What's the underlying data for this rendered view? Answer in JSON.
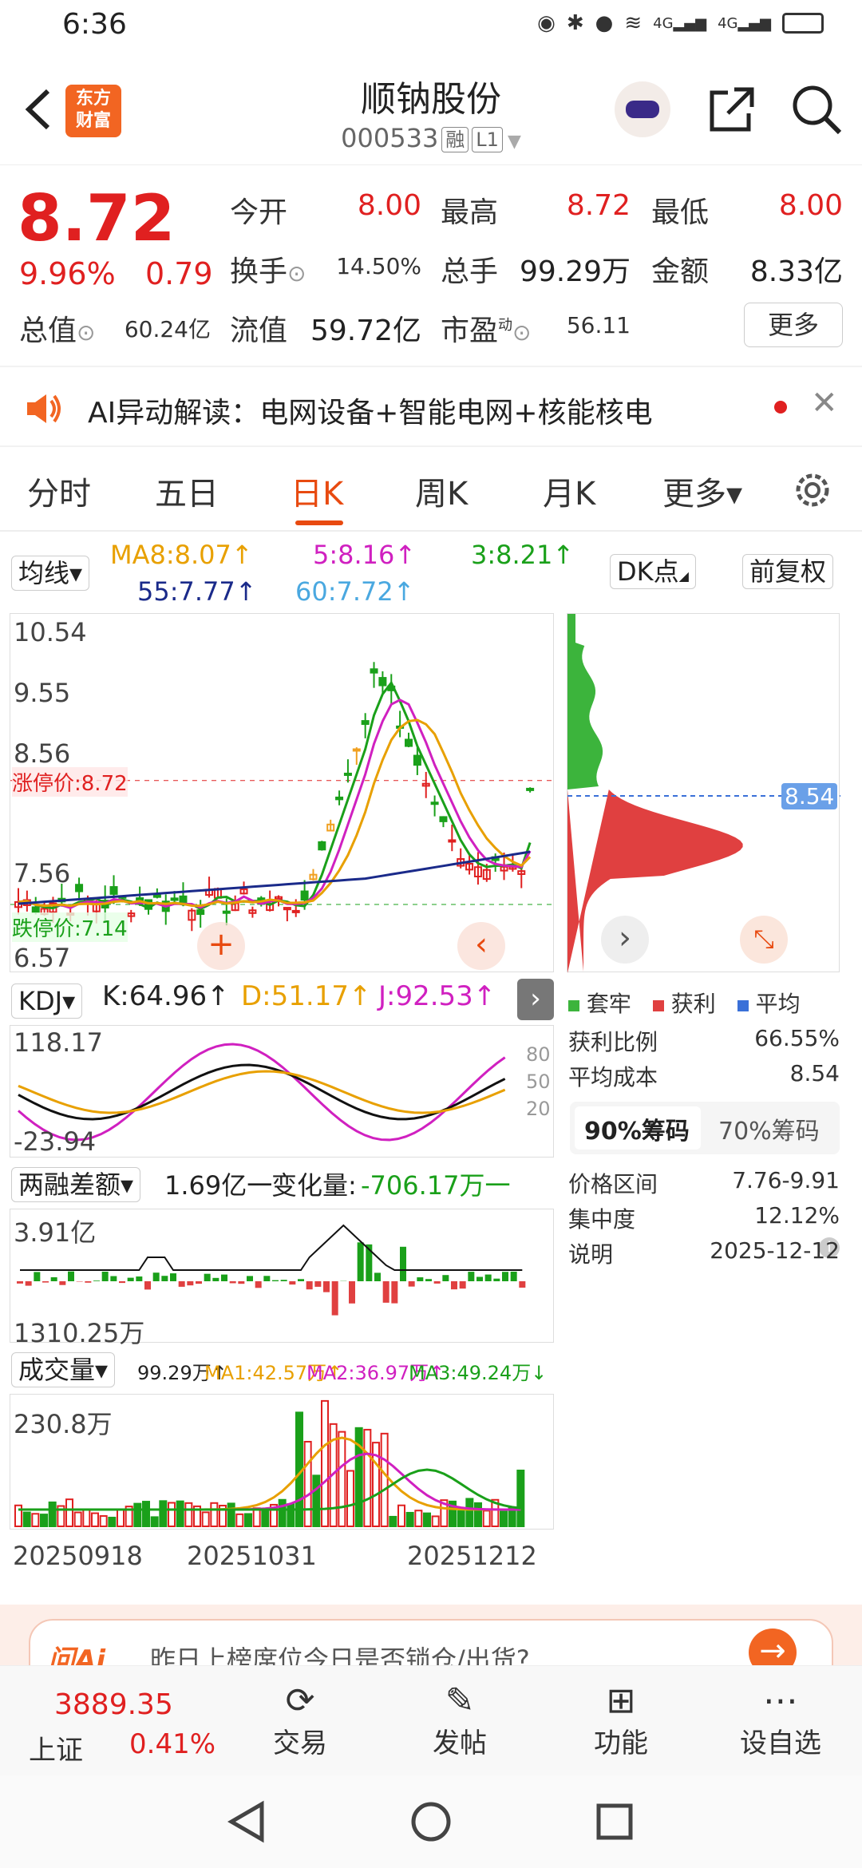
{
  "status": {
    "time": "6:36",
    "net1": "4G",
    "net2": "4G"
  },
  "header": {
    "logo_line1": "东方",
    "logo_line2": "财富",
    "title": "顺钠股份",
    "code": "000533",
    "tag1": "融",
    "tag2": "L1"
  },
  "quote": {
    "price": "8.72",
    "pct": "9.96%",
    "chg": "0.79",
    "open_lbl": "今开",
    "open": "8.00",
    "high_lbl": "最高",
    "high": "8.72",
    "low_lbl": "最低",
    "low": "8.00",
    "turn_lbl": "换手",
    "turn": "14.50%",
    "vol_lbl": "总手",
    "vol": "99.29万",
    "amt_lbl": "金额",
    "amt": "8.33亿",
    "mcap_lbl": "总值",
    "mcap": "60.24亿",
    "fcap_lbl": "流值",
    "fcap": "59.72亿",
    "pe_lbl": "市盈",
    "pe_sup": "动",
    "pe": "56.11",
    "more": "更多"
  },
  "ai": {
    "text": "AI异动解读：电网设备+智能电网+核能核电"
  },
  "tabs": [
    "分时",
    "五日",
    "日K",
    "周K",
    "月K",
    "更多▾"
  ],
  "kline": {
    "ma_select": "均线▾",
    "dk": "DK点",
    "fq": "前复权",
    "ma8": "MA8:8.07↑",
    "ma5": "5:8.16↑",
    "ma3": "3:8.21↑",
    "ma55": "55:7.77↑",
    "ma60": "60:7.72↑",
    "yticks": [
      "10.54",
      "9.55",
      "8.56",
      "7.56",
      "6.57"
    ],
    "limit_up": "涨停价:8.72",
    "limit_down": "跌停价:7.14",
    "cost_tag": "8.54"
  },
  "kdj": {
    "select": "KDJ▾",
    "k": "K:64.96↑",
    "d": "D:51.17↑",
    "j": "J:92.53↑",
    "ymax": "118.17",
    "ymin": "-23.94",
    "l80": "80",
    "l50": "50",
    "l20": "20"
  },
  "margin": {
    "select": "两融差额▾",
    "val": "1.69亿一",
    "chg_lbl": "变化量:",
    "chg": "-706.17万一",
    "ymax": "3.91亿",
    "ymin": "1310.25万"
  },
  "volume": {
    "select": "成交量▾",
    "v": "99.29万↑",
    "ma1": "MA1:42.57万↑",
    "ma2": "MA2:36.97万↑",
    "ma3": "MA3:49.24万↓",
    "ymax": "230.8万",
    "dates": [
      "20250918",
      "20251031",
      "20251212"
    ]
  },
  "chips": {
    "legend": [
      "套牢",
      "获利",
      "平均"
    ],
    "rows": [
      {
        "k": "获利比例",
        "v": "66.55%"
      },
      {
        "k": "平均成本",
        "v": "8.54"
      }
    ],
    "tab1": "90%筹码",
    "tab2": "70%筹码",
    "rows2": [
      {
        "k": "价格区间",
        "v": "7.76-9.91"
      },
      {
        "k": "集中度",
        "v": "12.12%"
      },
      {
        "k": "说明",
        "v": "2025-12-12"
      }
    ]
  },
  "banner": {
    "text": "昨日上榜席位今日是否锁仓/出货?"
  },
  "bottom": {
    "index_name": "上证",
    "index_val": "3889.35",
    "index_pct": "0.41%",
    "trade": "交易",
    "post": "发帖",
    "func": "功能",
    "custom": "设自选"
  },
  "colors": {
    "up": "#e02020",
    "down": "#1aa01a",
    "accent": "#e84a10"
  }
}
